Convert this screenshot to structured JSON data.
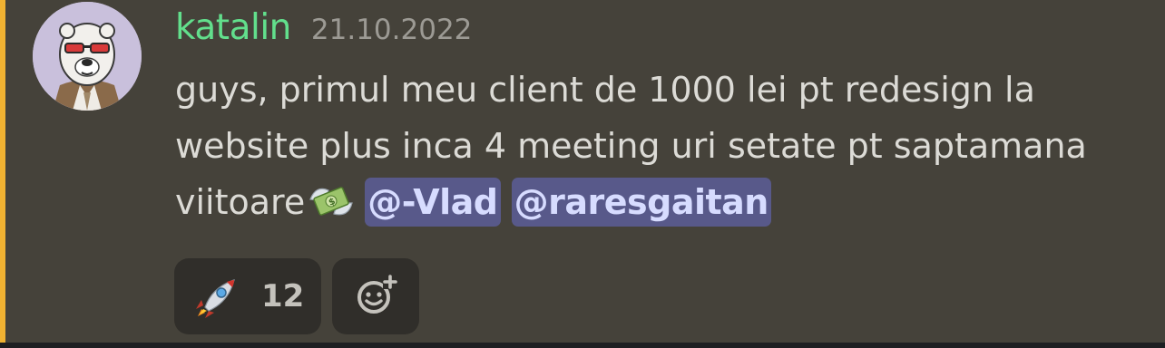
{
  "message": {
    "author": "katalin",
    "timestamp": "21.10.2022",
    "text_line_1": "guys, primul meu client de 1000 lei pt redesign la",
    "text_line_2": "website plus inca 4 meeting uri setate pt saptamana",
    "text_line_3": "viitoare",
    "inline_emoji": "money-with-wings-emoji",
    "mentions": [
      "@-Vlad",
      "@raresgaitan"
    ],
    "author_color": "#62df8c",
    "mention_bar_color": "#f0b232"
  },
  "reactions": [
    {
      "emoji": "rocket-emoji",
      "count": "12"
    }
  ],
  "add_reaction_icon": "add-reaction-smiley-icon"
}
